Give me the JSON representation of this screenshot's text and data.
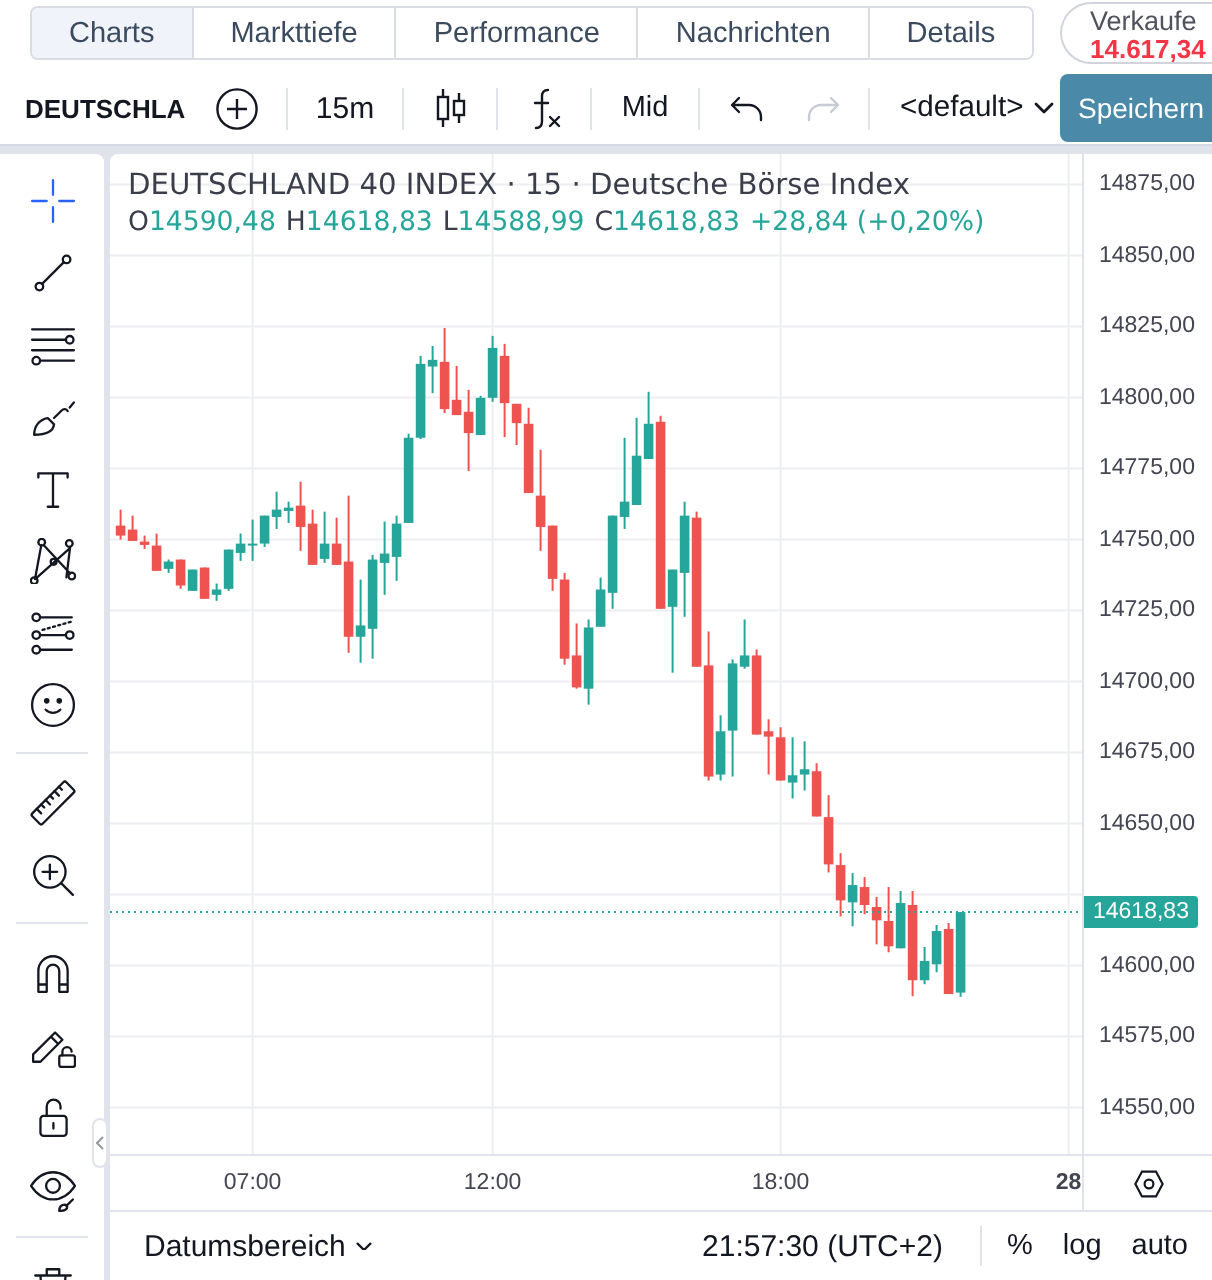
{
  "tabs": [
    {
      "label": "Charts",
      "selected": true
    },
    {
      "label": "Markttiefe",
      "selected": false
    },
    {
      "label": "Performance",
      "selected": false
    },
    {
      "label": "Nachrichten",
      "selected": false
    },
    {
      "label": "Details",
      "selected": false
    }
  ],
  "sell_button": {
    "label": "Verkaufe",
    "price": "14.617,34"
  },
  "toolbar": {
    "symbol": "DEUTSCHLA",
    "interval": "15m",
    "price_source": "Mid",
    "undo": {
      "disabled": false
    },
    "redo": {
      "disabled": true
    },
    "layout": "<default>",
    "save": "Speichern"
  },
  "drawing_tools": [
    [
      {
        "kind": "crosshair",
        "selected": true
      },
      {
        "kind": "trend_line",
        "selected": false
      },
      {
        "kind": "fib",
        "selected": false
      },
      {
        "kind": "brush",
        "selected": false
      },
      {
        "kind": "text",
        "selected": false
      },
      {
        "kind": "pattern",
        "selected": false
      },
      {
        "kind": "prediction",
        "selected": false
      },
      {
        "kind": "emoji",
        "selected": false
      }
    ],
    [
      {
        "kind": "ruler",
        "selected": false
      },
      {
        "kind": "zoom",
        "selected": false
      }
    ],
    [
      {
        "kind": "magnet",
        "selected": false
      },
      {
        "kind": "lock_drawings",
        "selected": false
      },
      {
        "kind": "lock",
        "selected": false
      },
      {
        "kind": "hide",
        "selected": false
      }
    ],
    [
      {
        "kind": "trash",
        "selected": false
      }
    ]
  ],
  "chart": {
    "title": "DEUTSCHLAND 40 INDEX · 15 · Deutsche Börse Index",
    "ohlc": [
      {
        "key": "O",
        "value": "14590,48"
      },
      {
        "key": "H",
        "value": "14618,83"
      },
      {
        "key": "L",
        "value": "14588,99"
      },
      {
        "key": "C",
        "value": "14618,83"
      }
    ],
    "change": "+28,84 (+0,20%)",
    "chart_data": {
      "type": "candlestick",
      "categories": [
        null,
        null,
        null,
        null,
        null,
        null,
        null,
        null,
        null,
        null,
        null,
        "07:00",
        null,
        null,
        null,
        null,
        null,
        null,
        null,
        null,
        null,
        null,
        null,
        null,
        null,
        null,
        null,
        null,
        null,
        null,
        null,
        "12:00",
        null,
        null,
        null,
        null,
        null,
        null,
        null,
        null,
        null,
        null,
        null,
        null,
        null,
        null,
        null,
        null,
        null,
        null,
        null,
        null,
        null,
        null,
        null,
        "18:00",
        null,
        null,
        null,
        null,
        null,
        null,
        null,
        null,
        null,
        null,
        null,
        null,
        null,
        null,
        null,
        null,
        null,
        null,
        null,
        null,
        null,
        null,
        null,
        "28"
      ],
      "ohlc": [
        [
          14754.92,
          14760.55,
          14750.0,
          14751.41
        ],
        [
          14753.52,
          14758.44,
          14749.53,
          14749.53
        ],
        [
          14749.3,
          14751.41,
          14746.72,
          14748.13
        ],
        [
          14747.89,
          14752.11,
          14738.98,
          14738.98
        ],
        [
          14739.69,
          14742.97,
          14738.28,
          14742.27
        ],
        [
          14742.97,
          14742.97,
          14732.66,
          14733.83
        ],
        [
          14731.95,
          14739.45,
          14731.95,
          14739.45
        ],
        [
          14740.16,
          14740.16,
          14729.14,
          14729.14
        ],
        [
          14730.55,
          14734.53,
          14728.44,
          14732.42
        ],
        [
          14732.66,
          14746.48,
          14731.95,
          14746.48
        ],
        [
          14745.31,
          14752.11,
          14742.5,
          14748.59
        ],
        [
          14748.13,
          14757.03,
          14742.5,
          14748.59
        ],
        [
          14748.59,
          14758.44,
          14747.42,
          14758.44
        ],
        [
          14757.97,
          14766.88,
          14753.75,
          14760.55
        ],
        [
          14760.08,
          14763.36,
          14755.86,
          14761.25
        ],
        [
          14761.95,
          14770.39,
          14746.02,
          14754.45
        ],
        [
          14755.63,
          14760.55,
          14741.09,
          14741.09
        ],
        [
          14743.2,
          14759.84,
          14741.8,
          14748.59
        ],
        [
          14748.59,
          14757.73,
          14741.09,
          14741.09
        ],
        [
          14742.27,
          14765.47,
          14710.16,
          14715.78
        ],
        [
          14715.78,
          14735.94,
          14706.64,
          14719.77
        ],
        [
          14718.59,
          14744.61,
          14708.05,
          14742.97
        ],
        [
          14741.8,
          14756.33,
          14730.55,
          14745.08
        ],
        [
          14743.91,
          14758.44,
          14735.47,
          14755.63
        ],
        [
          14755.86,
          14787.27,
          14755.86,
          14785.86
        ],
        [
          14785.86,
          14814.69,
          14785.39,
          14811.88
        ],
        [
          14810.94,
          14818.2,
          14801.56,
          14813.28
        ],
        [
          14812.58,
          14824.53,
          14794.53,
          14795.94
        ],
        [
          14799.22,
          14811.17,
          14793.83,
          14793.83
        ],
        [
          14795.0,
          14802.73,
          14774.14,
          14787.5
        ],
        [
          14786.8,
          14800.63,
          14786.8,
          14799.92
        ],
        [
          14799.92,
          14821.72,
          14798.52,
          14817.5
        ],
        [
          14814.69,
          14818.91,
          14786.09,
          14798.05
        ],
        [
          14797.81,
          14797.81,
          14783.28,
          14791.02
        ],
        [
          14790.78,
          14796.41,
          14766.41,
          14766.41
        ],
        [
          14765.47,
          14781.64,
          14746.02,
          14754.45
        ],
        [
          14754.92,
          14754.92,
          14731.95,
          14736.17
        ],
        [
          14735.94,
          14738.28,
          14705.94,
          14708.05
        ],
        [
          14709.22,
          14720.47,
          14697.5,
          14697.97
        ],
        [
          14697.5,
          14721.88,
          14691.88,
          14719.06
        ],
        [
          14719.3,
          14736.64,
          14719.3,
          14732.42
        ],
        [
          14731.25,
          14758.44,
          14725.63,
          14758.44
        ],
        [
          14757.97,
          14785.86,
          14753.75,
          14763.36
        ],
        [
          14762.19,
          14792.89,
          14762.19,
          14779.53
        ],
        [
          14778.36,
          14802.03,
          14778.36,
          14790.78
        ],
        [
          14791.48,
          14793.59,
          14725.63,
          14725.63
        ],
        [
          14726.33,
          14739.45,
          14703.13,
          14739.45
        ],
        [
          14738.28,
          14763.36,
          14722.81,
          14758.44
        ],
        [
          14757.73,
          14759.84,
          14705.23,
          14705.23
        ],
        [
          14705.7,
          14717.66,
          14665.16,
          14666.56
        ],
        [
          14667.27,
          14688.13,
          14665.16,
          14682.5
        ],
        [
          14682.73,
          14707.81,
          14666.56,
          14706.41
        ],
        [
          14705.23,
          14721.88,
          14704.53,
          14709.22
        ],
        [
          14709.22,
          14711.33,
          14681.33,
          14681.33
        ],
        [
          14682.5,
          14686.72,
          14667.27,
          14680.63
        ],
        [
          14680.39,
          14683.91,
          14665.16,
          14665.16
        ],
        [
          14664.45,
          14680.39,
          14658.83,
          14667.03
        ],
        [
          14667.27,
          14678.98,
          14661.64,
          14669.14
        ],
        [
          14668.44,
          14671.25,
          14652.5,
          14652.5
        ],
        [
          14652.27,
          14660.0,
          14632.81,
          14635.63
        ],
        [
          14635.39,
          14639.61,
          14617.34,
          14622.97
        ],
        [
          14622.27,
          14632.58,
          14613.83,
          14628.36
        ],
        [
          14627.66,
          14631.17,
          14618.05,
          14621.33
        ],
        [
          14620.63,
          14624.14,
          14607.5,
          14615.94
        ],
        [
          14615.7,
          14627.66,
          14604.69,
          14606.8
        ],
        [
          14606.09,
          14626.25,
          14606.09,
          14622.03
        ],
        [
          14621.33,
          14626.25,
          14589.22,
          14594.84
        ],
        [
          14594.84,
          14606.56,
          14593.44,
          14601.64
        ],
        [
          14600.47,
          14614.3,
          14597.66,
          14612.19
        ],
        [
          14612.89,
          14615.0,
          14589.99,
          14589.99
        ],
        [
          14590.48,
          14618.83,
          14588.99,
          14618.83
        ],
        null,
        null,
        null,
        null,
        null,
        null,
        null,
        null,
        null
      ],
      "ylim": [
        14533.66,
        14885.77
      ],
      "grid": true,
      "yticks": [
        {
          "value": 14875,
          "label": "14875,00"
        },
        {
          "value": 14850,
          "label": "14850,00"
        },
        {
          "value": 14825,
          "label": "14825,00"
        },
        {
          "value": 14800,
          "label": "14800,00"
        },
        {
          "value": 14775,
          "label": "14775,00"
        },
        {
          "value": 14750,
          "label": "14750,00"
        },
        {
          "value": 14725,
          "label": "14725,00"
        },
        {
          "value": 14700,
          "label": "14700,00"
        },
        {
          "value": 14675,
          "label": "14675,00"
        },
        {
          "value": 14650,
          "label": "14650,00"
        },
        {
          "value": 14600,
          "label": "14600,00"
        },
        {
          "value": 14575,
          "label": "14575,00"
        },
        {
          "value": 14550,
          "label": "14550,00"
        }
      ],
      "ref_lines": [
        {
          "axis": "y",
          "value": 14618.83,
          "label": "14618,83",
          "color": "#26a69a"
        }
      ]
    }
  },
  "bottom_bar": {
    "date_range": "Datumsbereich",
    "clock": "21:57:30 (UTC+2)",
    "scale_options": [
      "%",
      "log",
      "auto"
    ]
  }
}
